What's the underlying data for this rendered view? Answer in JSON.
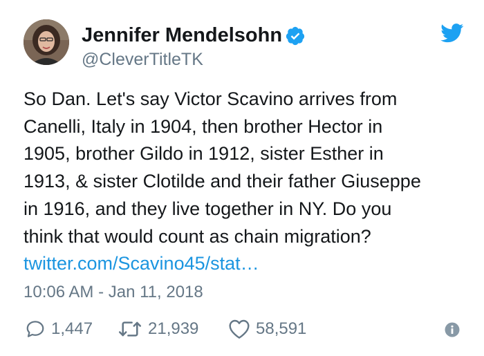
{
  "author": {
    "display_name": "Jennifer Mendelsohn",
    "handle": "@CleverTitleTK",
    "verified_icon": "verified-badge-icon",
    "avatar": "avatar-photo"
  },
  "brand": {
    "logo": "twitter-bird-icon",
    "accent_color": "#1da1f2",
    "link_color": "#1b95e0"
  },
  "tweet": {
    "text_lines": [
      "So Dan. Let's say Victor Scavino arrives from",
      "Canelli, Italy in 1904, then brother Hector in",
      "1905, brother Gildo in 1912, sister Esther in",
      "1913, & sister Clotilde and their father Giuseppe",
      "in 1916, and they live together in NY. Do you",
      "think that would count as chain migration?"
    ],
    "link_text": "twitter.com/Scavino45/stat…",
    "timestamp": "10:06 AM - Jan 11, 2018"
  },
  "actions": {
    "replies": "1,447",
    "retweets": "21,939",
    "likes": "58,591"
  }
}
